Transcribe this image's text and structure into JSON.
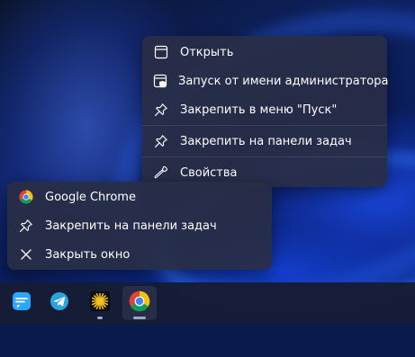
{
  "jump_list": {
    "items": [
      {
        "label": "Открыть",
        "icon": "window-icon"
      },
      {
        "label": "Запуск от имени администратора",
        "icon": "admin-shield-icon"
      },
      {
        "label": "Закрепить в меню \"Пуск\"",
        "icon": "pin-icon"
      },
      {
        "label": "Закрепить на панели задач",
        "icon": "pin-icon"
      },
      {
        "label": "Свойства",
        "icon": "wrench-icon"
      }
    ]
  },
  "window_menu": {
    "items": [
      {
        "label": "Google Chrome",
        "icon": "chrome-icon"
      },
      {
        "label": "Закрепить на панели задач",
        "icon": "pin-icon"
      },
      {
        "label": "Закрыть окно",
        "icon": "close-icon"
      }
    ]
  },
  "taskbar": {
    "apps": [
      {
        "name": "messenger-app",
        "icon": "chat-bubble-icon",
        "color": "#2aa8ff"
      },
      {
        "name": "telegram",
        "icon": "telegram-icon",
        "color": "#2aa3e0"
      },
      {
        "name": "star-app",
        "icon": "starburst-icon",
        "color": "#f4c21b",
        "running": true
      },
      {
        "name": "google-chrome",
        "icon": "chrome-icon",
        "active": true
      }
    ]
  },
  "colors": {
    "menu_bg": "#2c3147",
    "text": "#ffffff",
    "taskbar_bg": "#161c34",
    "accent_blue": "#1e50e6"
  }
}
